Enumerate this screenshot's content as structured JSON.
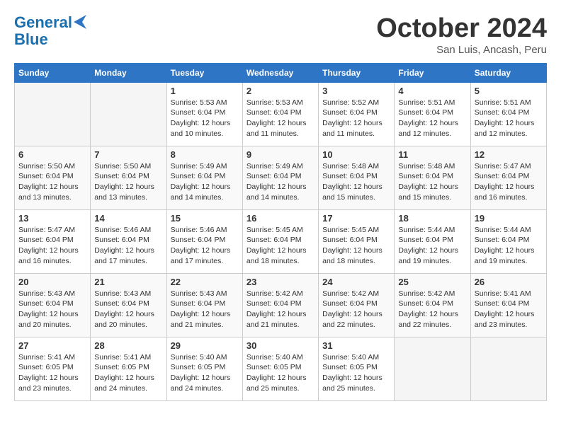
{
  "logo": {
    "line1": "General",
    "line2": "Blue"
  },
  "title": "October 2024",
  "location": "San Luis, Ancash, Peru",
  "weekdays": [
    "Sunday",
    "Monday",
    "Tuesday",
    "Wednesday",
    "Thursday",
    "Friday",
    "Saturday"
  ],
  "weeks": [
    [
      {
        "day": "",
        "info": ""
      },
      {
        "day": "",
        "info": ""
      },
      {
        "day": "1",
        "info": "Sunrise: 5:53 AM\nSunset: 6:04 PM\nDaylight: 12 hours\nand 10 minutes."
      },
      {
        "day": "2",
        "info": "Sunrise: 5:53 AM\nSunset: 6:04 PM\nDaylight: 12 hours\nand 11 minutes."
      },
      {
        "day": "3",
        "info": "Sunrise: 5:52 AM\nSunset: 6:04 PM\nDaylight: 12 hours\nand 11 minutes."
      },
      {
        "day": "4",
        "info": "Sunrise: 5:51 AM\nSunset: 6:04 PM\nDaylight: 12 hours\nand 12 minutes."
      },
      {
        "day": "5",
        "info": "Sunrise: 5:51 AM\nSunset: 6:04 PM\nDaylight: 12 hours\nand 12 minutes."
      }
    ],
    [
      {
        "day": "6",
        "info": "Sunrise: 5:50 AM\nSunset: 6:04 PM\nDaylight: 12 hours\nand 13 minutes."
      },
      {
        "day": "7",
        "info": "Sunrise: 5:50 AM\nSunset: 6:04 PM\nDaylight: 12 hours\nand 13 minutes."
      },
      {
        "day": "8",
        "info": "Sunrise: 5:49 AM\nSunset: 6:04 PM\nDaylight: 12 hours\nand 14 minutes."
      },
      {
        "day": "9",
        "info": "Sunrise: 5:49 AM\nSunset: 6:04 PM\nDaylight: 12 hours\nand 14 minutes."
      },
      {
        "day": "10",
        "info": "Sunrise: 5:48 AM\nSunset: 6:04 PM\nDaylight: 12 hours\nand 15 minutes."
      },
      {
        "day": "11",
        "info": "Sunrise: 5:48 AM\nSunset: 6:04 PM\nDaylight: 12 hours\nand 15 minutes."
      },
      {
        "day": "12",
        "info": "Sunrise: 5:47 AM\nSunset: 6:04 PM\nDaylight: 12 hours\nand 16 minutes."
      }
    ],
    [
      {
        "day": "13",
        "info": "Sunrise: 5:47 AM\nSunset: 6:04 PM\nDaylight: 12 hours\nand 16 minutes."
      },
      {
        "day": "14",
        "info": "Sunrise: 5:46 AM\nSunset: 6:04 PM\nDaylight: 12 hours\nand 17 minutes."
      },
      {
        "day": "15",
        "info": "Sunrise: 5:46 AM\nSunset: 6:04 PM\nDaylight: 12 hours\nand 17 minutes."
      },
      {
        "day": "16",
        "info": "Sunrise: 5:45 AM\nSunset: 6:04 PM\nDaylight: 12 hours\nand 18 minutes."
      },
      {
        "day": "17",
        "info": "Sunrise: 5:45 AM\nSunset: 6:04 PM\nDaylight: 12 hours\nand 18 minutes."
      },
      {
        "day": "18",
        "info": "Sunrise: 5:44 AM\nSunset: 6:04 PM\nDaylight: 12 hours\nand 19 minutes."
      },
      {
        "day": "19",
        "info": "Sunrise: 5:44 AM\nSunset: 6:04 PM\nDaylight: 12 hours\nand 19 minutes."
      }
    ],
    [
      {
        "day": "20",
        "info": "Sunrise: 5:43 AM\nSunset: 6:04 PM\nDaylight: 12 hours\nand 20 minutes."
      },
      {
        "day": "21",
        "info": "Sunrise: 5:43 AM\nSunset: 6:04 PM\nDaylight: 12 hours\nand 20 minutes."
      },
      {
        "day": "22",
        "info": "Sunrise: 5:43 AM\nSunset: 6:04 PM\nDaylight: 12 hours\nand 21 minutes."
      },
      {
        "day": "23",
        "info": "Sunrise: 5:42 AM\nSunset: 6:04 PM\nDaylight: 12 hours\nand 21 minutes."
      },
      {
        "day": "24",
        "info": "Sunrise: 5:42 AM\nSunset: 6:04 PM\nDaylight: 12 hours\nand 22 minutes."
      },
      {
        "day": "25",
        "info": "Sunrise: 5:42 AM\nSunset: 6:04 PM\nDaylight: 12 hours\nand 22 minutes."
      },
      {
        "day": "26",
        "info": "Sunrise: 5:41 AM\nSunset: 6:04 PM\nDaylight: 12 hours\nand 23 minutes."
      }
    ],
    [
      {
        "day": "27",
        "info": "Sunrise: 5:41 AM\nSunset: 6:05 PM\nDaylight: 12 hours\nand 23 minutes."
      },
      {
        "day": "28",
        "info": "Sunrise: 5:41 AM\nSunset: 6:05 PM\nDaylight: 12 hours\nand 24 minutes."
      },
      {
        "day": "29",
        "info": "Sunrise: 5:40 AM\nSunset: 6:05 PM\nDaylight: 12 hours\nand 24 minutes."
      },
      {
        "day": "30",
        "info": "Sunrise: 5:40 AM\nSunset: 6:05 PM\nDaylight: 12 hours\nand 25 minutes."
      },
      {
        "day": "31",
        "info": "Sunrise: 5:40 AM\nSunset: 6:05 PM\nDaylight: 12 hours\nand 25 minutes."
      },
      {
        "day": "",
        "info": ""
      },
      {
        "day": "",
        "info": ""
      }
    ]
  ]
}
